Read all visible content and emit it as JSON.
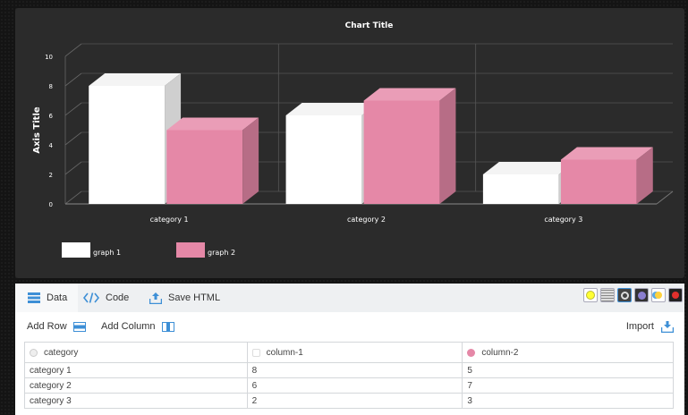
{
  "chart_data": {
    "type": "bar",
    "title": "Chart Title",
    "ylabel": "Axis Title",
    "xlabel": "",
    "categories": [
      "category 1",
      "category 2",
      "category 3"
    ],
    "series": [
      {
        "name": "graph 1",
        "values": [
          8,
          6,
          2
        ],
        "color": "#ffffff"
      },
      {
        "name": "graph 2",
        "values": [
          5,
          7,
          3
        ],
        "color": "#e588a7"
      }
    ],
    "ylim": [
      0,
      10
    ],
    "yticks": [
      "0",
      "2",
      "4",
      "6",
      "8",
      "10"
    ],
    "grid": true,
    "legend_position": "bottom-left",
    "background": "#2b2b2b"
  },
  "tabs": {
    "data": "Data",
    "code": "Code",
    "save_html": "Save HTML"
  },
  "theme_swatches": [
    {
      "name": "yellow-dot-theme",
      "color": "#ffff33"
    },
    {
      "name": "striped-theme",
      "color": "#bbbbbb"
    },
    {
      "name": "dark-ring-theme",
      "color": "#333333"
    },
    {
      "name": "purple-theme",
      "color": "#8a7fd0"
    },
    {
      "name": "blue-yellow-theme",
      "color": "#ffd23f"
    },
    {
      "name": "red-dark-theme",
      "color": "#e0302c"
    }
  ],
  "toolbar": {
    "add_row": "Add Row",
    "add_column": "Add Column",
    "import": "Import"
  },
  "table": {
    "headers": [
      {
        "label": "category",
        "color": "#d4d7da"
      },
      {
        "label": "column-1",
        "color": "#ffffff"
      },
      {
        "label": "column-2",
        "color": "#e588a7"
      }
    ],
    "rows": [
      [
        "category 1",
        "8",
        "5"
      ],
      [
        "category 2",
        "6",
        "7"
      ],
      [
        "category 3",
        "2",
        "3"
      ]
    ]
  },
  "colors": {
    "accent_blue": "#3d8fd6",
    "chart_bg": "#2b2b2b",
    "series_1": "#ffffff",
    "series_2": "#e588a7"
  }
}
